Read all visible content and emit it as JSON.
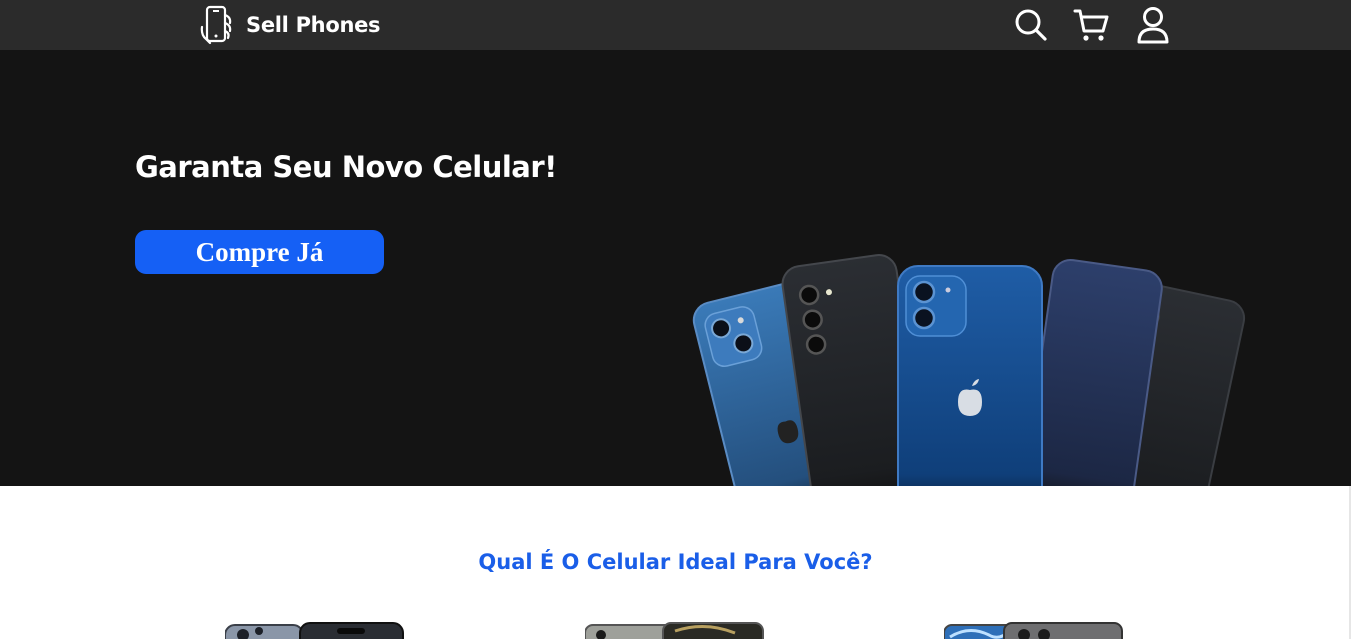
{
  "navbar": {
    "brand": "Sell Phones",
    "logo_icon": "phone-hand-icon",
    "icons": [
      "search-icon",
      "cart-icon",
      "user-icon"
    ]
  },
  "hero": {
    "title": "Garanta Seu Novo Celular!",
    "cta_label": "Compre Já",
    "image": "phones-showcase-image"
  },
  "section": {
    "title": "Qual É O Celular Ideal Para Você?"
  },
  "products": [
    {
      "image": "iphone-15-pro-image"
    },
    {
      "image": "samsung-galaxy-image"
    },
    {
      "image": "motorola-phone-image"
    }
  ],
  "colors": {
    "navbar_bg": "#2b2b2b",
    "hero_bg": "#141414",
    "accent": "#1560f5",
    "section_title": "#1a5ee8"
  }
}
